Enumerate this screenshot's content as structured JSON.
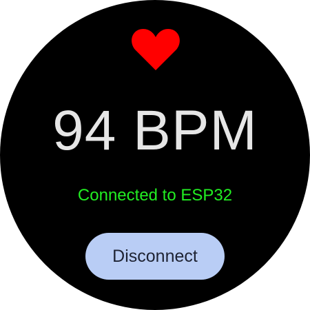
{
  "heart_icon": "heart-icon",
  "reading": {
    "value": "94 BPM"
  },
  "status": {
    "text": "Connected to ESP32",
    "color": "#22ee22"
  },
  "actions": {
    "disconnect_label": "Disconnect",
    "button_color": "#b9cdf5"
  },
  "colors": {
    "background": "#000000",
    "heart": "#ff0000",
    "text": "#e6e6e6"
  }
}
